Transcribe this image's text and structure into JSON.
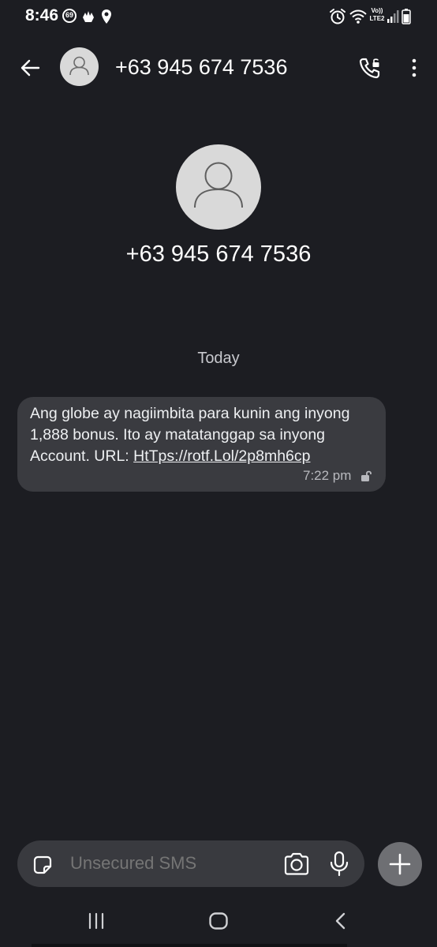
{
  "status_bar": {
    "time": "8:46",
    "notification_count": "69",
    "network_label_top": "Vo))",
    "network_label_bottom": "LTE2"
  },
  "app_bar": {
    "title": "+63 945 674 7536",
    "back_icon": "arrow-left-icon",
    "call_icon": "phone-icon",
    "more_icon": "more-vertical-icon"
  },
  "contact": {
    "name": "+63 945 674 7536",
    "avatar_icon": "person-icon"
  },
  "conversation": {
    "day_label": "Today",
    "messages": [
      {
        "text_before_link": "Ang globe ay nagiimbita para kunin ang inyong 1,888 bonus. Ito ay matatanggap sa inyong Account. URL: ",
        "link": "HtTps://rotf.Lol/2p8mh6cp",
        "time": "7:22 pm",
        "lock_icon": "unlocked-lock-icon"
      }
    ]
  },
  "composer": {
    "placeholder": "Unsecured SMS",
    "sticker_icon": "sticker-icon",
    "camera_icon": "camera-icon",
    "mic_icon": "microphone-icon",
    "add_icon": "plus-icon"
  },
  "navigation": {
    "recents_icon": "recent-apps-icon",
    "home_icon": "home-icon",
    "back_icon": "nav-back-icon"
  },
  "colors": {
    "background": "#1c1d22",
    "bubble": "#3a3b40",
    "composer": "#393a3f",
    "avatar": "#d9d9d9"
  }
}
